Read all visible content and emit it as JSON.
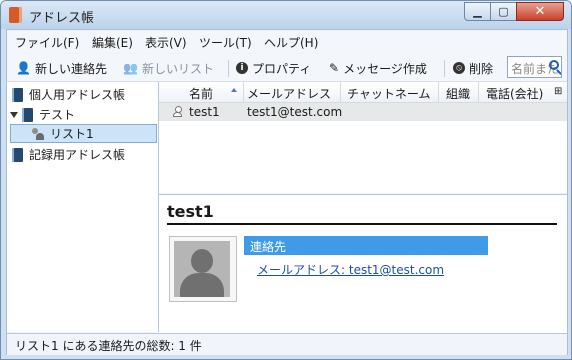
{
  "window": {
    "title": "アドレス帳"
  },
  "menu": [
    {
      "label": "ファイル(F)"
    },
    {
      "label": "編集(E)"
    },
    {
      "label": "表示(V)"
    },
    {
      "label": "ツール(T)"
    },
    {
      "label": "ヘルプ(H)"
    }
  ],
  "toolbar": {
    "new_contact": "新しい連絡先",
    "new_list": "新しいリスト",
    "properties": "プロパティ",
    "compose": "メッセージ作成",
    "delete": "削除",
    "search_placeholder": "名前また"
  },
  "sidebar": {
    "items": [
      {
        "label": "個人用アドレス帳"
      },
      {
        "label": "テスト"
      },
      {
        "label": "リスト1"
      },
      {
        "label": "記録用アドレス帳"
      }
    ]
  },
  "list": {
    "columns": [
      "名前",
      "メールアドレス",
      "チャットネーム",
      "組織",
      "電話(会社)"
    ],
    "rows": [
      {
        "name": "test1",
        "email": "test1@test.com"
      }
    ]
  },
  "detail": {
    "name": "test1",
    "section_label": "連絡先",
    "email_line": "メールアドレス: test1@test.com"
  },
  "status": {
    "text": "リスト1 にある連絡先の総数: 1 件"
  },
  "colors": {
    "selection": "#3f9be8",
    "link": "#1a4fa8",
    "row_highlight": "#e6e8ea"
  }
}
